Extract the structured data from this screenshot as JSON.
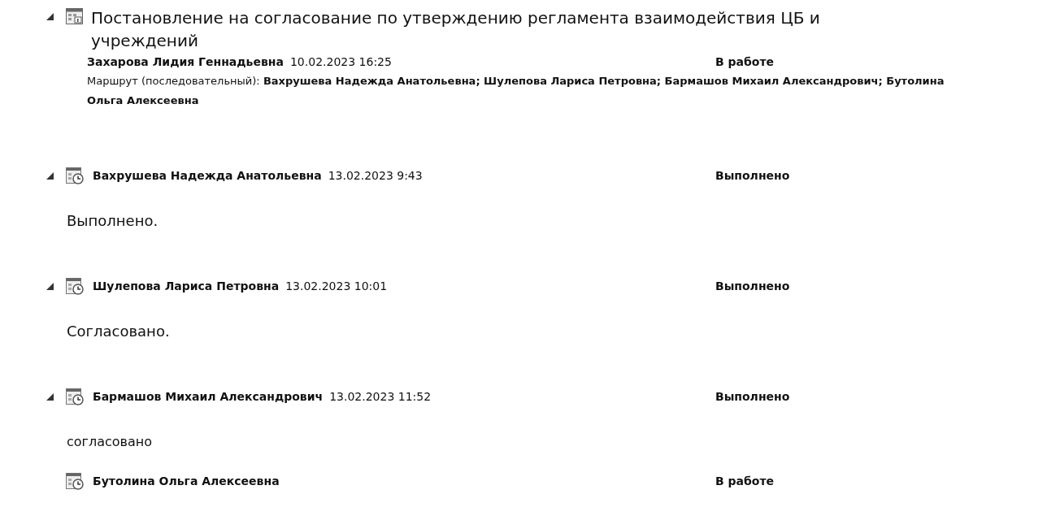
{
  "document": {
    "expanded": true,
    "title": "Постановление на согласование по утверждению регламента взаимодействия ЦБ и учреждений",
    "author": "Захарова Лидия Геннадьевна",
    "date": "10.02.2023 16:25",
    "status": "В работе",
    "route": "Маршрут (последовательный): **Вахрушева Надежда Анатольевна; Шулепова Лариса Петровна; Бармашов Михаил Александрович; Бутолина Ольга Алексеевна**",
    "children": [
      {
        "expanded": true,
        "name": "Вахрушева Надежда Анатольевна",
        "date": "13.02.2023 9:43",
        "status": "Выполнено",
        "comment": "Выполнено."
      },
      {
        "expanded": true,
        "name": "Шулепова Лариса Петровна",
        "date": "13.02.2023 10:01",
        "status": "Выполнено",
        "comment": "Согласовано."
      },
      {
        "expanded": true,
        "name": "Бармашов Михаил Александрович",
        "date": "13.02.2023 11:52",
        "status": "Выполнено",
        "comment": "согласовано"
      },
      {
        "expanded": false,
        "name": "Бутолина Ольга Алексеевна",
        "status": "В работе"
      }
    ]
  }
}
